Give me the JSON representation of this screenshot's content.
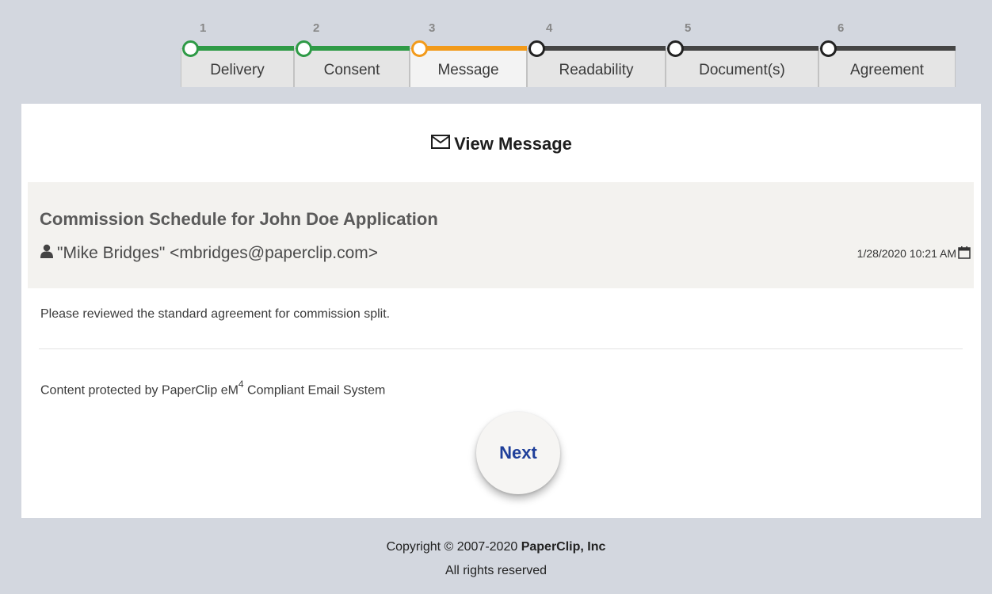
{
  "stepper": {
    "steps": [
      {
        "num": "1",
        "label": "Delivery",
        "state": "done"
      },
      {
        "num": "2",
        "label": "Consent",
        "state": "done"
      },
      {
        "num": "3",
        "label": "Message",
        "state": "current"
      },
      {
        "num": "4",
        "label": "Readability",
        "state": "todo"
      },
      {
        "num": "5",
        "label": "Document(s)",
        "state": "todo"
      },
      {
        "num": "6",
        "label": "Agreement",
        "state": "todo"
      }
    ],
    "colors": {
      "done": "#2e9a46",
      "current": "#f29a1a",
      "todo": "#454545"
    }
  },
  "card": {
    "title": "View Message",
    "title_icon": "envelope-icon",
    "subject": "Commission Schedule for John Doe Application",
    "sender": "\"Mike Bridges\" <mbridges@paperclip.com>",
    "sender_icon": "user-icon",
    "date": "1/28/2020 10:21 AM",
    "date_icon": "calendar-icon",
    "body": "Please reviewed the standard agreement for commission split.",
    "protected_prefix": "Content protected by PaperClip eM",
    "protected_sup": "4",
    "protected_suffix": " Compliant Email System",
    "next_label": "Next"
  },
  "footer": {
    "copyright_prefix": "Copyright © 2007-2020 ",
    "company": "PaperClip, Inc",
    "rights": "All rights reserved"
  }
}
